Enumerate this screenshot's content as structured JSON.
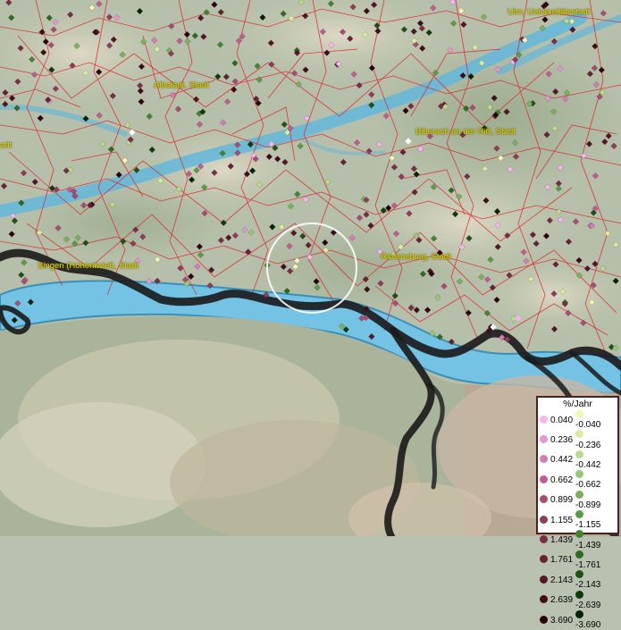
{
  "colors": {
    "water": "#63b7dc",
    "lake": "#74c3e4",
    "district_lines": "#e0202a",
    "border": "#111111",
    "city_label": "#dede00"
  },
  "cities": [
    {
      "name": "Ulm, Universitätsstadt"
    },
    {
      "name": "Albstadt, Stadt"
    },
    {
      "name": "Biberach an der Riß, Stadt"
    },
    {
      "name": "Ravensburg, Stadt"
    },
    {
      "name": "Singen (Hohentwiel), Stadt"
    },
    {
      "name": "adt"
    }
  ],
  "legend": {
    "title": "%/Jahr",
    "positive": [
      {
        "label": "0.040",
        "color": "#f4b6ef"
      },
      {
        "label": "0.236",
        "color": "#e596cf"
      },
      {
        "label": "0.442",
        "color": "#d57cb4"
      },
      {
        "label": "0.662",
        "color": "#bf5f8f"
      },
      {
        "label": "0.899",
        "color": "#a84c72"
      },
      {
        "label": "1.155",
        "color": "#8f3c5a"
      },
      {
        "label": "1.439",
        "color": "#7a2e44"
      },
      {
        "label": "1.761",
        "color": "#662233"
      },
      {
        "label": "2.143",
        "color": "#521626"
      },
      {
        "label": "2.639",
        "color": "#3f0c18"
      },
      {
        "label": "3.690",
        "color": "#2a040c"
      }
    ],
    "negative": [
      {
        "label": "-0.040",
        "color": "#f4f6b4"
      },
      {
        "label": "-0.236",
        "color": "#d8eba0"
      },
      {
        "label": "-0.442",
        "color": "#b9dc8a"
      },
      {
        "label": "-0.662",
        "color": "#97c874"
      },
      {
        "label": "-0.899",
        "color": "#77b25c"
      },
      {
        "label": "-1.155",
        "color": "#5c9b46"
      },
      {
        "label": "-1.439",
        "color": "#418432"
      },
      {
        "label": "-1.761",
        "color": "#2c6c22"
      },
      {
        "label": "-2.143",
        "color": "#1a5416"
      },
      {
        "label": "-2.639",
        "color": "#0c3c0c"
      },
      {
        "label": "-3.690",
        "color": "#032404"
      }
    ]
  }
}
